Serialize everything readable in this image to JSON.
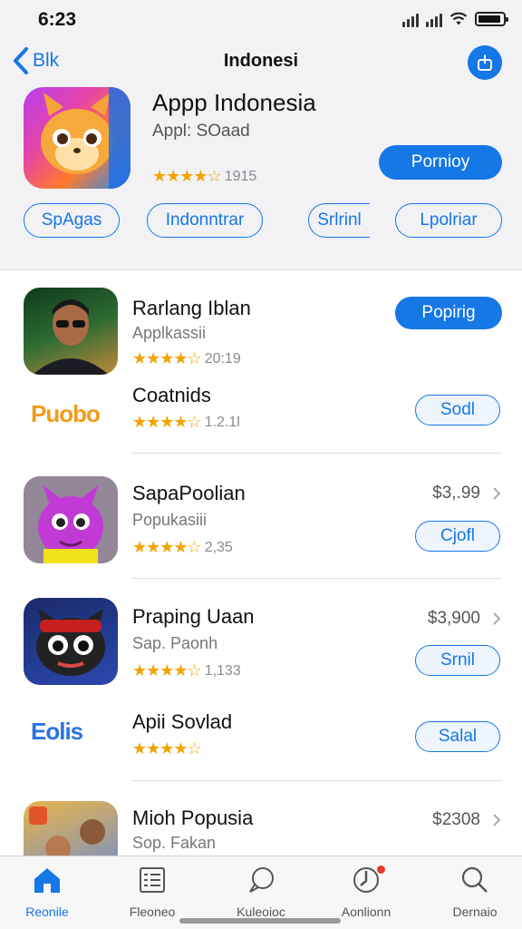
{
  "status_bar": {
    "time": "6:23"
  },
  "nav": {
    "back_label": "Blk",
    "title": "Indonesi"
  },
  "hero": {
    "title": "Appp Indonesia",
    "subtitle": "Appl: SOaad",
    "stars": "★★★★☆",
    "rating_count": "1915",
    "primary_label": "Pornioy",
    "pills": [
      "SpAgas",
      "Indonntrar",
      "Srlrinl",
      "Lpolriar"
    ]
  },
  "apps": [
    {
      "title": "Rarlang Iblan",
      "subtitle": "Applkassii",
      "stars": "★★★★☆",
      "rating_count": "20:19",
      "button": "Popirig"
    },
    {
      "title": "Coatnids",
      "logo": "Puobo",
      "stars": "★★★★☆",
      "rating_count": "1.2.1l",
      "button": "Sodl"
    },
    {
      "title": "SapaPoolian",
      "subtitle": "Popukasiii",
      "stars": "★★★★☆",
      "rating_count": "2,35",
      "price": "$3,.99",
      "button": "Cjofl"
    },
    {
      "title": "Praping Uaan",
      "subtitle": "Sap. Paonh",
      "stars": "★★★★☆",
      "rating_count": "1,133",
      "price": "$3,900",
      "button": "Srnil"
    },
    {
      "title": "Apii Sovlad",
      "logo": "Eolis",
      "stars": "★★★★☆",
      "button": "Salal"
    },
    {
      "title": "Mioh Popusia",
      "subtitle": "Sop. Fakan",
      "price": "$2308"
    }
  ],
  "tabbar": {
    "items": [
      {
        "label": "Reonile",
        "icon": "home-icon"
      },
      {
        "label": "Fleoneo",
        "icon": "list-icon"
      },
      {
        "label": "Kuleoioc",
        "icon": "chat-icon"
      },
      {
        "label": "Aonlionn",
        "icon": "updates-icon"
      },
      {
        "label": "Dernaio",
        "icon": "search-icon"
      }
    ],
    "active_color": "#1677e6"
  },
  "colors": {
    "accent": "#1677e6",
    "star": "#f4a300"
  }
}
